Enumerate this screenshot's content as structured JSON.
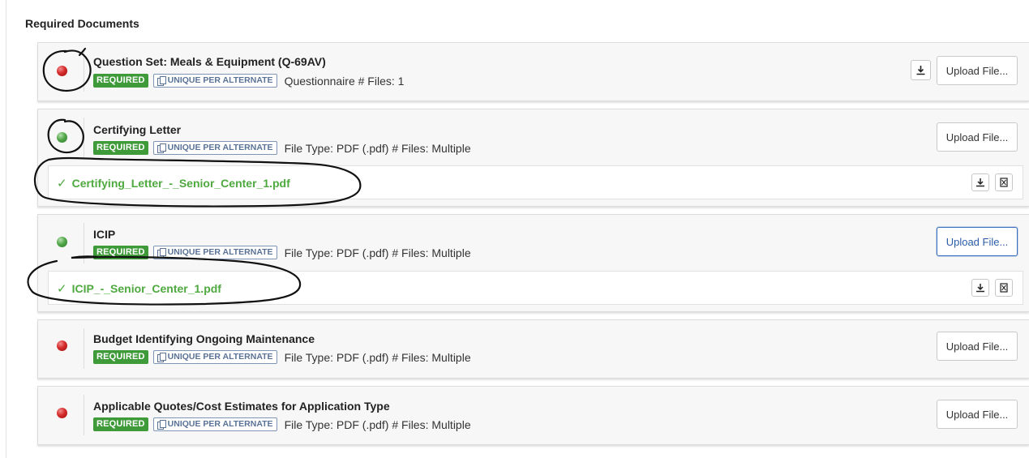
{
  "section_title": "Required Documents",
  "colors": {
    "required_badge": "#3f9a3a",
    "file_link": "#4ea93f",
    "status_incomplete": "#d62b2b",
    "status_complete": "#53a84a",
    "focus_border": "#3a6fbe"
  },
  "documents": [
    {
      "title": "Question Set: Meals & Equipment (Q-69AV)",
      "status": "incomplete",
      "required_label": "REQUIRED",
      "unique_label": "UNIQUE PER ALTERNATE",
      "meta": "Questionnaire  # Files: 1",
      "upload_label": "Upload File...",
      "has_download": true,
      "files": []
    },
    {
      "title": "Certifying Letter",
      "status": "complete",
      "required_label": "REQUIRED",
      "unique_label": "UNIQUE PER ALTERNATE",
      "meta": "File Type: PDF (.pdf)  # Files: Multiple",
      "upload_label": "Upload File...",
      "files": [
        {
          "check": "✓",
          "name": "Certifying_Letter_-_Senior_Center_1.pdf"
        }
      ]
    },
    {
      "title": "ICIP",
      "status": "complete",
      "required_label": "REQUIRED",
      "unique_label": "UNIQUE PER ALTERNATE",
      "meta": "File Type: PDF (.pdf)  # Files: Multiple",
      "upload_label": "Upload File...",
      "upload_focused": true,
      "files": [
        {
          "check": "✓",
          "name": "ICIP_-_Senior_Center_1.pdf"
        }
      ]
    },
    {
      "title": "Budget Identifying Ongoing Maintenance",
      "status": "incomplete",
      "required_label": "REQUIRED",
      "unique_label": "UNIQUE PER ALTERNATE",
      "meta": "File Type: PDF (.pdf)  # Files: Multiple",
      "upload_label": "Upload File...",
      "files": []
    },
    {
      "title": "Applicable Quotes/Cost Estimates for Application Type",
      "status": "incomplete",
      "required_label": "REQUIRED",
      "unique_label": "UNIQUE PER ALTERNATE",
      "meta": "File Type: PDF (.pdf)  # Files: Multiple",
      "upload_label": "Upload File...",
      "files": []
    }
  ]
}
